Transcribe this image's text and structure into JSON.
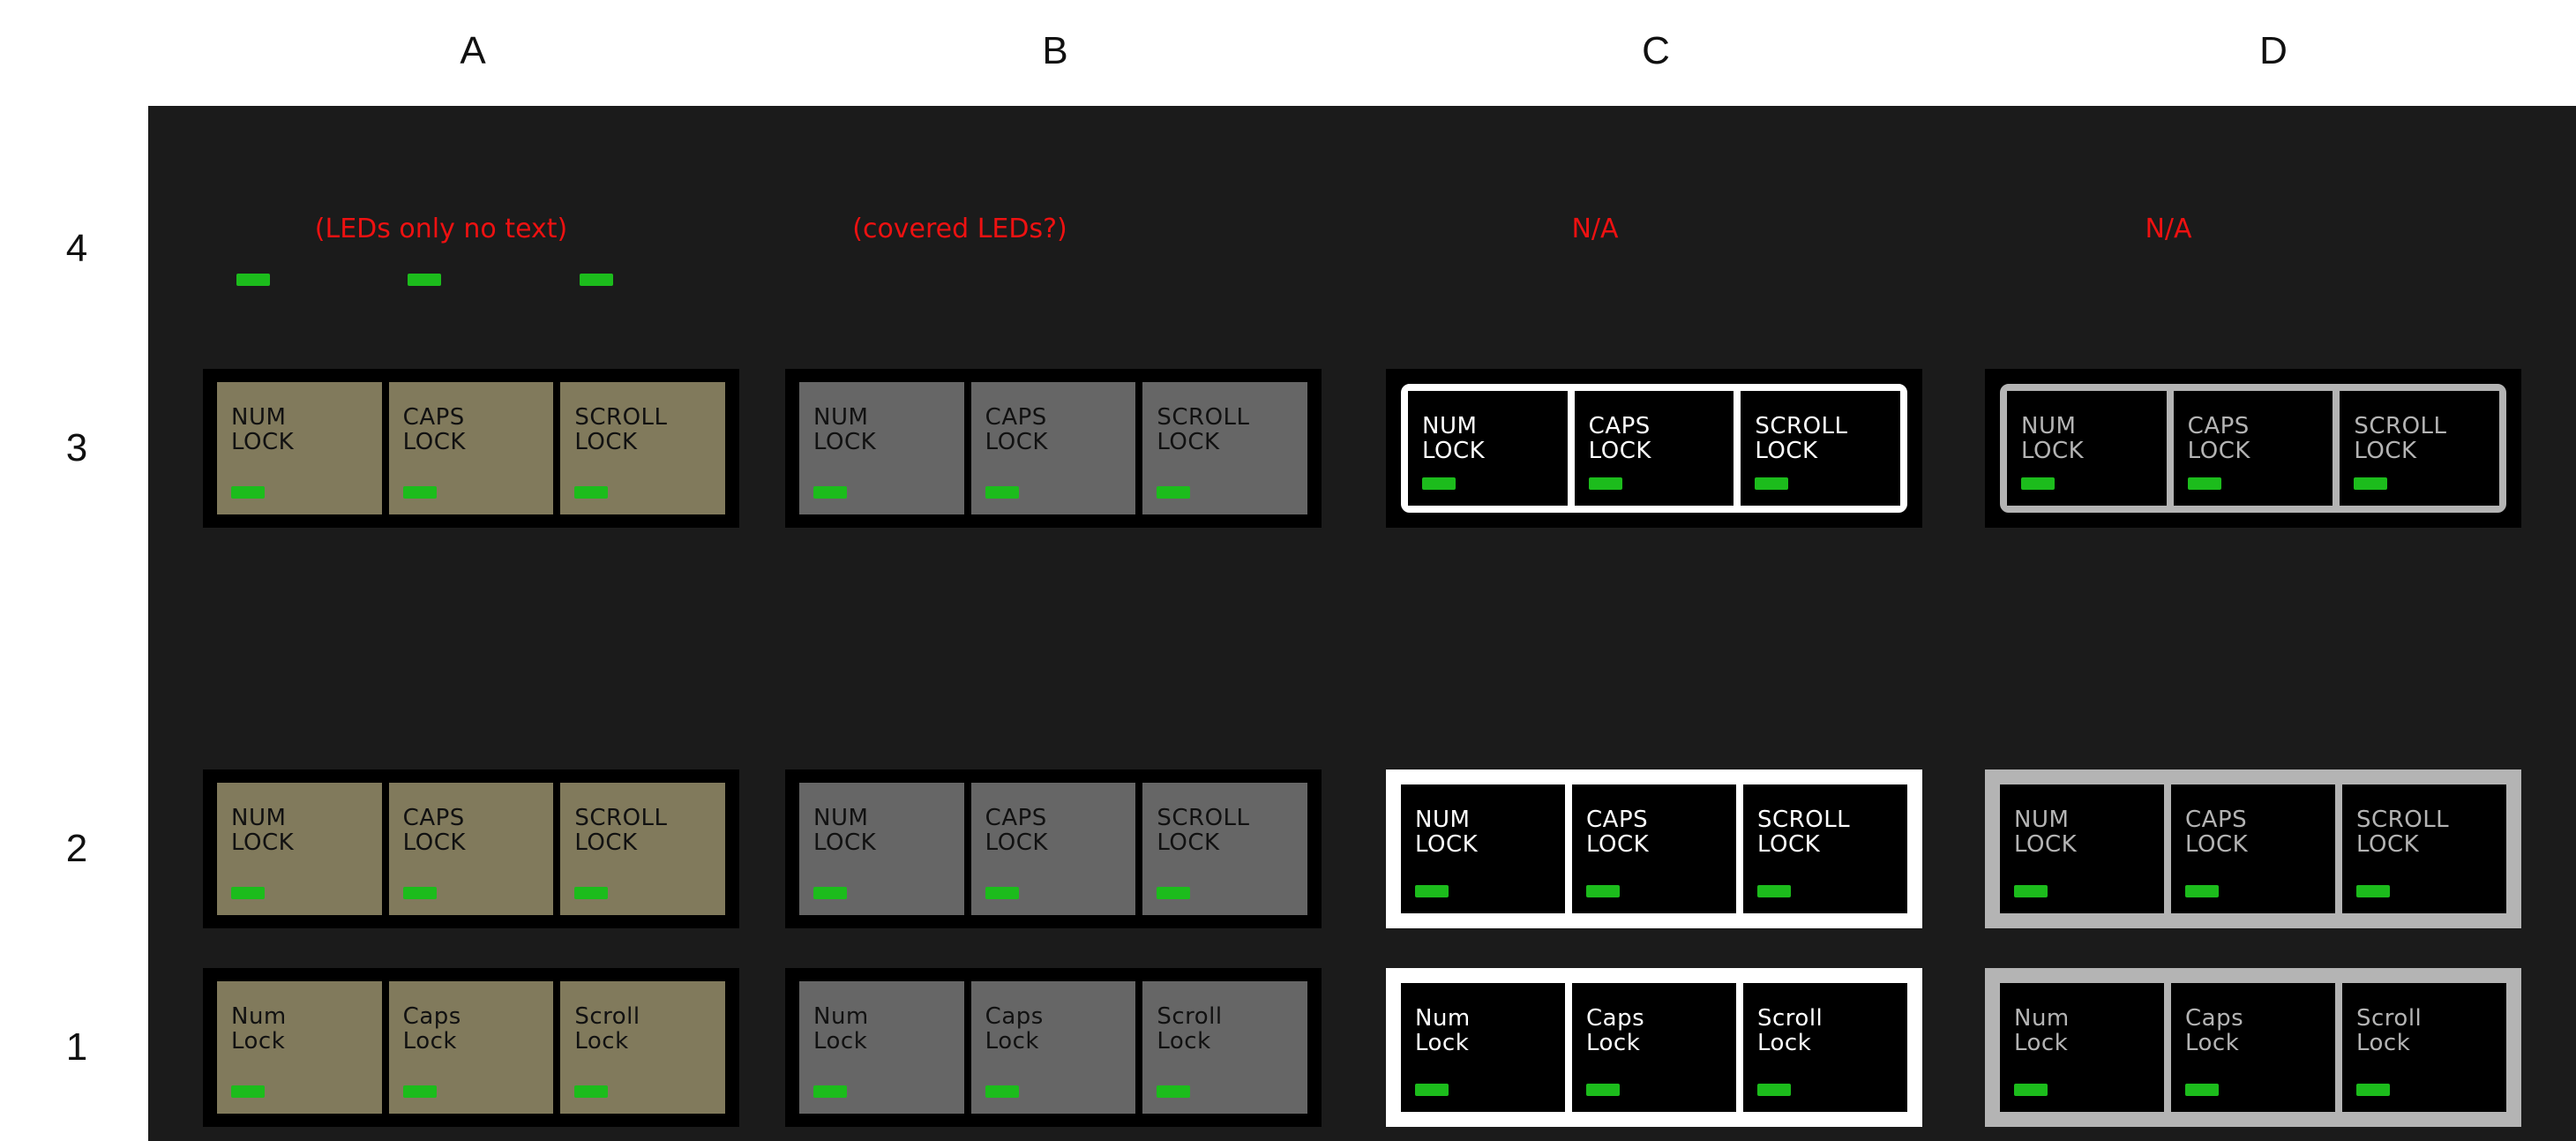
{
  "columns": [
    "A",
    "B",
    "C",
    "D"
  ],
  "rows": [
    "4",
    "3",
    "2",
    "1"
  ],
  "colors": {
    "led": "#1cbc1c",
    "note": "#ee1111",
    "panel": "#1b1b1b",
    "khaki": "#817a5c",
    "gray": "#666666",
    "white": "#ffffff",
    "light_gray": "#b4b4b4"
  },
  "notes": {
    "A": "(LEDs only no text)",
    "B": "(covered LEDs?)",
    "C": "N/A",
    "D": "N/A"
  },
  "labels_upper": [
    "NUM\nLOCK",
    "CAPS\nLOCK",
    "SCROLL\nLOCK"
  ],
  "labels_mixed": [
    "Num\nLock",
    "Caps\nLock",
    "Scroll\nLock"
  ],
  "variants": {
    "A": {
      "key_bg": "#817a5c",
      "text": "#111111"
    },
    "B": {
      "key_bg": "#666666",
      "text": "#111111"
    },
    "C": {
      "key_bg": "#000000",
      "text": "#ffffff",
      "frame": "#ffffff"
    },
    "D": {
      "key_bg": "#000000",
      "text": "#b4b4b4",
      "frame": "#b4b4b4"
    }
  },
  "lone_leds": [
    "led-1",
    "led-2",
    "led-3"
  ]
}
